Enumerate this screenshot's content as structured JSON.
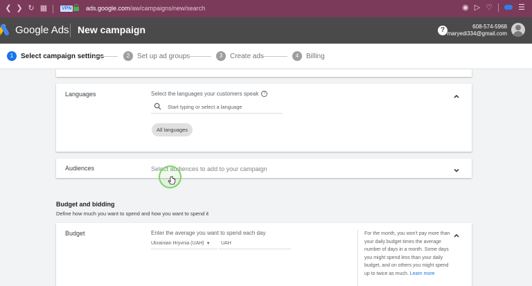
{
  "browser": {
    "vpn_label": "VPN",
    "url_host": "ads.google.com",
    "url_path": "/aw/campaigns/new/search"
  },
  "header": {
    "brand": "Google Ads",
    "title": "New campaign",
    "account_phone": "608-574-5968",
    "account_email": "maryedi334@gmail.com"
  },
  "stepper": {
    "steps": [
      {
        "num": "1",
        "label": "Select campaign settings"
      },
      {
        "num": "2",
        "label": "Set up ad groups"
      },
      {
        "num": "3",
        "label": "Create ads"
      },
      {
        "num": "4",
        "label": "Billing"
      }
    ]
  },
  "languages": {
    "label": "Languages",
    "prompt": "Select the languages your customers speak",
    "search_placeholder": "Start typing or select a language",
    "chip": "All languages"
  },
  "audiences": {
    "label": "Audiences",
    "prompt": "Select audiences to add to your campaign"
  },
  "budget_section": {
    "title": "Budget and bidding",
    "subtitle": "Define how much you want to spend and how you want to spend it"
  },
  "budget": {
    "label": "Budget",
    "prompt": "Enter the average you want to spend each day",
    "currency": "Ukrainian Hryvnia (UAH)",
    "amount_prefix": "UAH",
    "help_text": "For the month, you won't pay more than your daily budget times the average number of days in a month. Some days you might spend less than your daily budget, and on others you might spend up to twice as much.",
    "learn_more": "Learn more"
  }
}
